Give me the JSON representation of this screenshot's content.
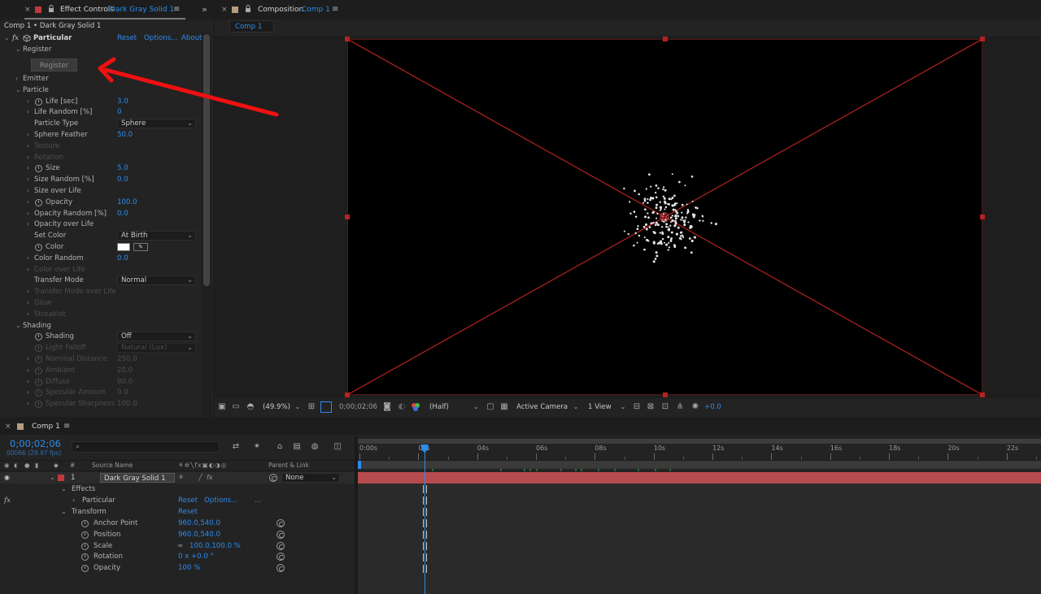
{
  "effect_controls": {
    "tab_close": "×",
    "tab_title": "Effect Controls",
    "tab_layer": "Dark Gray Solid 1",
    "menu_icon": "≡",
    "breadcrumb": "Comp 1 • Dark Gray Solid 1",
    "effect": {
      "fx_label": "fx",
      "name": "Particular",
      "reset": "Reset",
      "options": "Options...",
      "about": "About"
    },
    "register_group": "Register",
    "register_button": "Register",
    "rows": [
      {
        "indent": 1,
        "twirl": "›",
        "label": "Emitter"
      },
      {
        "indent": 1,
        "twirl": "⌄",
        "label": "Particle"
      },
      {
        "indent": 2,
        "twirl": "›",
        "sw": true,
        "label": "Life [sec]",
        "value": "3.0"
      },
      {
        "indent": 2,
        "twirl": "›",
        "label": "Life Random [%]",
        "value": "0"
      },
      {
        "indent": 2,
        "label": "Particle Type",
        "dropdown": "Sphere"
      },
      {
        "indent": 2,
        "twirl": "›",
        "label": "Sphere Feather",
        "value": "50.0"
      },
      {
        "indent": 2,
        "twirl": "›",
        "label": "Texture",
        "disabled": true
      },
      {
        "indent": 2,
        "twirl": "›",
        "label": "Rotation",
        "disabled": true
      },
      {
        "indent": 2,
        "twirl": "›",
        "sw": true,
        "label": "Size",
        "value": "5.0"
      },
      {
        "indent": 2,
        "twirl": "›",
        "label": "Size Random [%]",
        "value": "0.0"
      },
      {
        "indent": 2,
        "twirl": "›",
        "label": "Size over Life"
      },
      {
        "indent": 2,
        "twirl": "›",
        "sw": true,
        "label": "Opacity",
        "value": "100.0"
      },
      {
        "indent": 2,
        "twirl": "›",
        "label": "Opacity Random [%]",
        "value": "0.0"
      },
      {
        "indent": 2,
        "twirl": "›",
        "label": "Opacity over Life"
      },
      {
        "indent": 2,
        "label": "Set Color",
        "dropdown": "At Birth"
      },
      {
        "indent": 2,
        "sw": true,
        "label": "Color",
        "swatch": "#ffffff"
      },
      {
        "indent": 2,
        "twirl": "›",
        "label": "Color Random",
        "value": "0.0"
      },
      {
        "indent": 2,
        "twirl": "›",
        "label": "Color over Life",
        "disabled": true
      },
      {
        "indent": 2,
        "label": "Transfer Mode",
        "dropdown": "Normal"
      },
      {
        "indent": 2,
        "twirl": "›",
        "label": "Transfer Mode over Life",
        "disabled": true
      },
      {
        "indent": 2,
        "twirl": "›",
        "label": "Glow",
        "disabled": true
      },
      {
        "indent": 2,
        "twirl": "›",
        "label": "Streaklet",
        "disabled": true
      },
      {
        "indent": 1,
        "twirl": "⌄",
        "label": "Shading"
      },
      {
        "indent": 2,
        "sw": true,
        "label": "Shading",
        "dropdown": "Off"
      },
      {
        "indent": 2,
        "sw": true,
        "label": "Light Falloff",
        "dropdown": "Natural (Lux)",
        "disabled": true
      },
      {
        "indent": 2,
        "twirl": "›",
        "sw": true,
        "label": "Nominal Distance",
        "value": "250.0",
        "disabled": true
      },
      {
        "indent": 2,
        "twirl": "›",
        "sw": true,
        "label": "Ambient",
        "value": "20.0",
        "disabled": true
      },
      {
        "indent": 2,
        "twirl": "›",
        "sw": true,
        "label": "Diffuse",
        "value": "80.0",
        "disabled": true
      },
      {
        "indent": 2,
        "twirl": "›",
        "sw": true,
        "label": "Specular Amount",
        "value": "0.0",
        "disabled": true
      },
      {
        "indent": 2,
        "twirl": "›",
        "sw": true,
        "label": "Specular Sharpness",
        "value": "100.0",
        "disabled": true
      }
    ]
  },
  "composition": {
    "tab_close": "×",
    "tab_title": "Composition",
    "tab_comp": "Comp 1",
    "menu_icon": "≡",
    "subtab": "Comp 1",
    "expand_icon": "»",
    "toolbar": {
      "zoom": "(49.9%)",
      "timecode": "0;00;02;06",
      "resolution": "(Half)",
      "camera": "Active Camera",
      "views": "1 View",
      "exposure": "+0.0"
    },
    "particle_seed": 7,
    "particle_count": 190
  },
  "timeline": {
    "tab_close": "×",
    "tab_title": "Comp 1",
    "menu_icon": "≡",
    "timecode": "0;00;02;06",
    "frame_info": "00066 (29.97 fps)",
    "search_placeholder": "",
    "columns": {
      "num": "#",
      "source_name": "Source Name",
      "parent": "Parent & Link"
    },
    "layer": {
      "number": "1",
      "name": "Dark Gray Solid 1",
      "parent": "None"
    },
    "effects_label": "Effects",
    "particular_label": "Particular",
    "particular_reset": "Reset",
    "particular_options": "Options...",
    "particular_dots": "...",
    "fx_icon": "fx",
    "transform_label": "Transform",
    "transform_reset": "Reset",
    "props": [
      {
        "label": "Anchor Point",
        "value": "960.0,540.0"
      },
      {
        "label": "Position",
        "value": "960.0,540.0"
      },
      {
        "label": "Scale",
        "value": "100.0,100.0 %",
        "link": true
      },
      {
        "label": "Rotation",
        "value": "0 x +0.0 °"
      },
      {
        "label": "Opacity",
        "value": "100 %"
      }
    ],
    "ruler": [
      "0:00s",
      "02s",
      "04s",
      "06s",
      "08s",
      "10s",
      "12s",
      "14s",
      "16s",
      "18s",
      "20s",
      "22s"
    ],
    "duration_seconds": 23,
    "current_time_seconds": 2.2
  },
  "colors": {
    "accent": "#2d8ceb",
    "layer_bar": "#b64b4f",
    "bounds": "#b52222",
    "arrow": "#ee1111"
  }
}
